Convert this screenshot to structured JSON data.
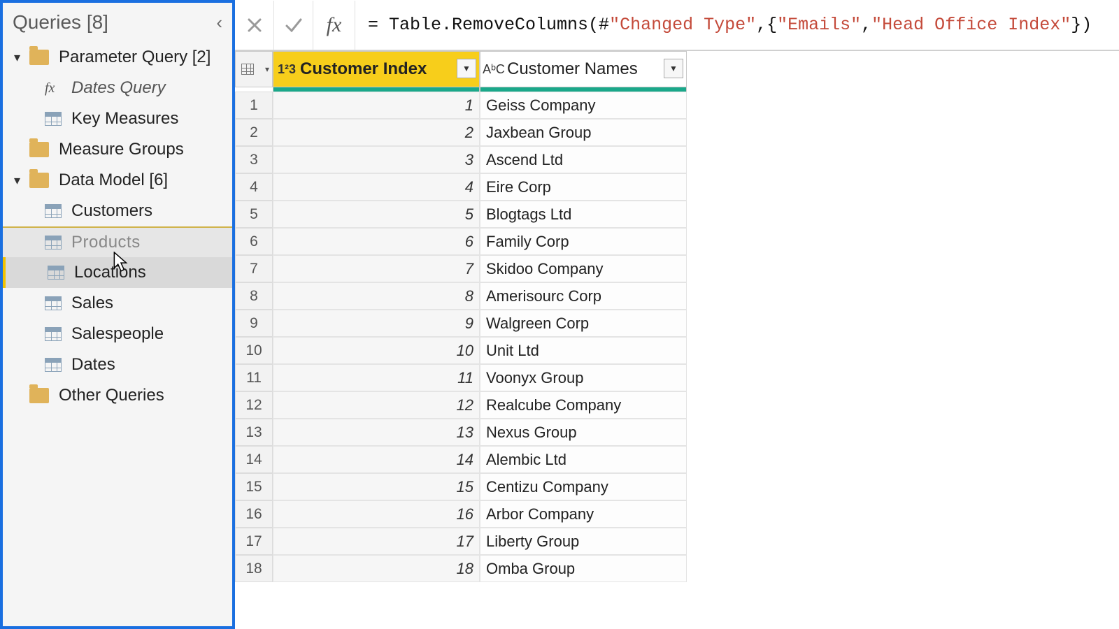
{
  "sidebar": {
    "title": "Queries [8]",
    "groups": [
      {
        "label": "Parameter Query [2]",
        "expanded": true,
        "items": [
          {
            "label": "Dates Query",
            "icon": "fx",
            "italic": true
          },
          {
            "label": "Key Measures",
            "icon": "table"
          }
        ]
      },
      {
        "label": "Measure Groups",
        "expanded": false,
        "items": []
      },
      {
        "label": "Data Model [6]",
        "expanded": true,
        "items": [
          {
            "label": "Customers",
            "icon": "table"
          },
          {
            "label": "Products",
            "icon": "table",
            "state": "dragging"
          },
          {
            "label": "Locations",
            "icon": "table",
            "state": "selected"
          },
          {
            "label": "Sales",
            "icon": "table"
          },
          {
            "label": "Salespeople",
            "icon": "table"
          },
          {
            "label": "Dates",
            "icon": "table"
          }
        ]
      },
      {
        "label": "Other Queries",
        "expanded": false,
        "items": []
      }
    ]
  },
  "formula_bar": {
    "prefix": "= Table.RemoveColumns(#",
    "arg_ref": "\"Changed Type\"",
    "mid": ",{",
    "arg1": "\"Emails\"",
    "sep": ", ",
    "arg2": "\"Head Office Index\"",
    "suffix": "})"
  },
  "grid": {
    "columns": [
      {
        "name": "Customer Index",
        "type_icon": "1²3",
        "selected": true
      },
      {
        "name": "Customer Names",
        "type_icon": "AᵇC",
        "selected": false
      }
    ],
    "rows": [
      {
        "n": 1,
        "index": 1,
        "name": "Geiss Company"
      },
      {
        "n": 2,
        "index": 2,
        "name": "Jaxbean Group"
      },
      {
        "n": 3,
        "index": 3,
        "name": "Ascend Ltd"
      },
      {
        "n": 4,
        "index": 4,
        "name": "Eire Corp"
      },
      {
        "n": 5,
        "index": 5,
        "name": "Blogtags Ltd"
      },
      {
        "n": 6,
        "index": 6,
        "name": "Family Corp"
      },
      {
        "n": 7,
        "index": 7,
        "name": "Skidoo Company"
      },
      {
        "n": 8,
        "index": 8,
        "name": "Amerisourc Corp"
      },
      {
        "n": 9,
        "index": 9,
        "name": "Walgreen Corp"
      },
      {
        "n": 10,
        "index": 10,
        "name": "Unit Ltd"
      },
      {
        "n": 11,
        "index": 11,
        "name": "Voonyx Group"
      },
      {
        "n": 12,
        "index": 12,
        "name": "Realcube Company"
      },
      {
        "n": 13,
        "index": 13,
        "name": "Nexus Group"
      },
      {
        "n": 14,
        "index": 14,
        "name": "Alembic Ltd"
      },
      {
        "n": 15,
        "index": 15,
        "name": "Centizu Company"
      },
      {
        "n": 16,
        "index": 16,
        "name": "Arbor Company"
      },
      {
        "n": 17,
        "index": 17,
        "name": "Liberty Group"
      },
      {
        "n": 18,
        "index": 18,
        "name": "Omba Group"
      }
    ]
  }
}
